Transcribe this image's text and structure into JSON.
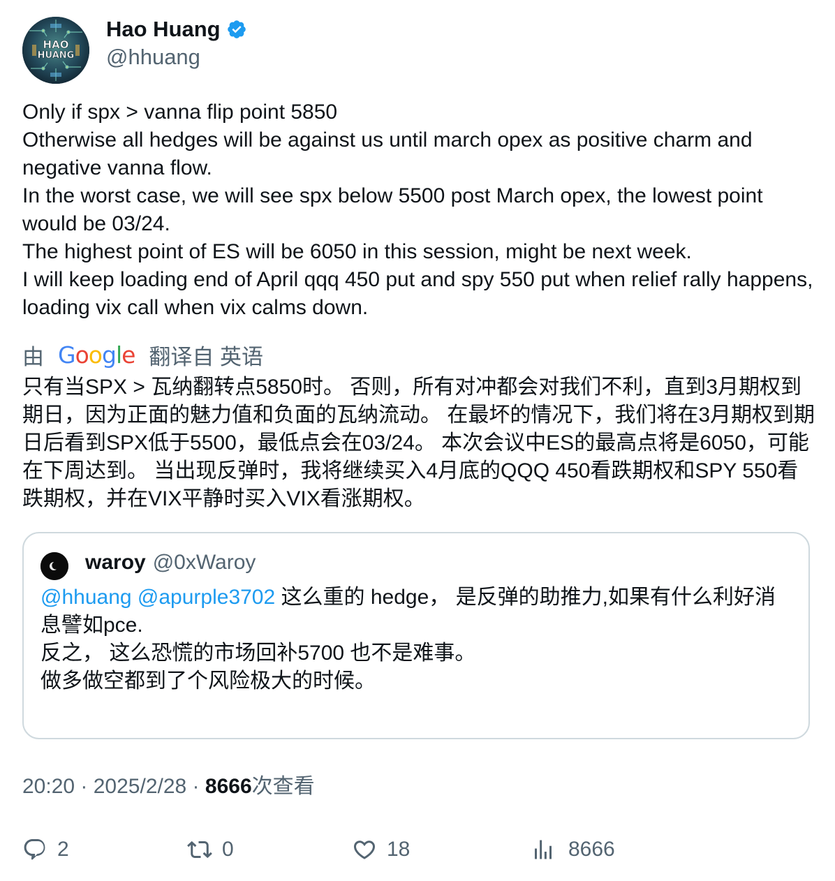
{
  "author": {
    "display_name": "Hao Huang",
    "handle": "@hhuang",
    "verified": true,
    "avatar_text_1": "HAO",
    "avatar_text_2": "HUANG"
  },
  "tweet": {
    "lines": [
      "Only if spx > vanna flip point 5850",
      "Otherwise all hedges will be against us until march opex as positive charm and negative vanna flow.",
      "In the worst case, we will see spx below 5500 post March opex, the lowest point would be 03/24.",
      "The highest point of ES will be 6050 in this session, might be next week.",
      "I will keep loading end of April qqq 450 put and spy 550 put when relief rally happens, loading vix call when vix calms down."
    ]
  },
  "translation": {
    "prefix": "由",
    "google_letters": [
      "G",
      "o",
      "o",
      "g",
      "l",
      "e"
    ],
    "suffix": "翻译自 英语",
    "text": "只有当SPX > 瓦纳翻转点5850时。 否则，所有对冲都会对我们不利，直到3月期权到期日，因为正面的魅力值和负面的瓦纳流动。 在最坏的情况下，我们将在3月期权到期日后看到SPX低于5500，最低点会在03/24。 本次会议中ES的最高点将是6050，可能在下周达到。 当出现反弹时，我将继续买入4月底的QQQ 450看跌期权和SPY 550看跌期权，并在VIX平静时买入VIX看涨期权。"
  },
  "quoted_tweet": {
    "display_name": "waroy",
    "handle": "@0xWaroy",
    "mention_1": "@hhuang",
    "mention_2": "@apurple3702",
    "line_1_rest": " 这么重的 hedge， 是反弹的助推力,如果有什么利好消息譬如pce.",
    "line_2": "反之， 这么恐慌的市场回补5700 也不是难事。",
    "line_3": "做多做空都到了个风险极大的时候。"
  },
  "meta": {
    "time": "20:20",
    "separator": " · ",
    "date": "2025/2/28",
    "views_count": "8666",
    "views_label": "次查看"
  },
  "actions": {
    "replies": "2",
    "reposts": "0",
    "likes": "18",
    "views": "8666"
  },
  "colors": {
    "text_primary": "#0f1419",
    "text_secondary": "#536471",
    "link": "#1d9bf0",
    "verified": "#1d9bf0",
    "border": "#cfd9de"
  }
}
